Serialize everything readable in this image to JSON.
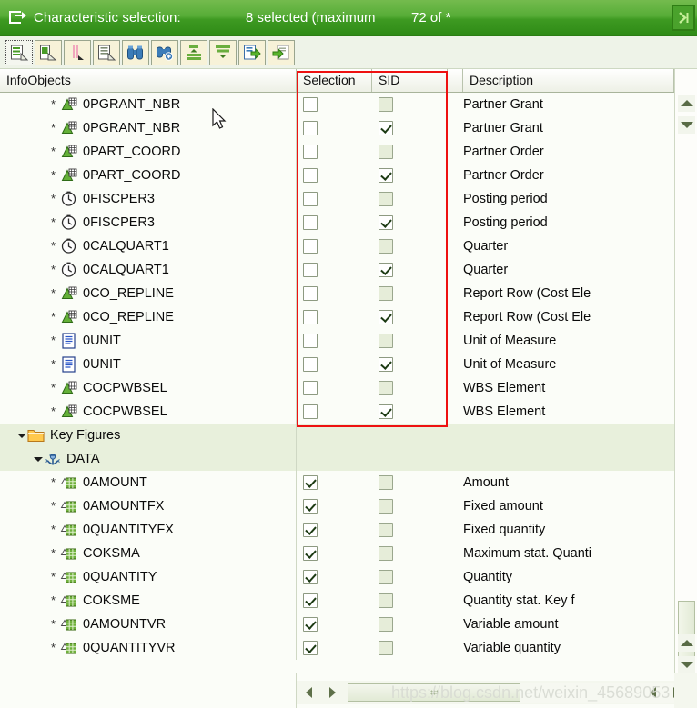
{
  "window": {
    "icon": "selection-window-icon",
    "title": "Characteristic selection:",
    "selected_info": "8 selected (maximum",
    "count_info": "72 of *",
    "close_label": "⌫"
  },
  "toolbar": {
    "buttons": [
      {
        "name": "select-all-button",
        "tip": "Select All"
      },
      {
        "name": "select-block-button",
        "tip": "Select Block"
      },
      {
        "name": "deselect-all-button",
        "tip": "Deselect All"
      },
      {
        "name": "find-button",
        "tip": "Find"
      },
      {
        "name": "find-next-button",
        "tip": "Find Next"
      },
      {
        "name": "expand-nodes-button",
        "tip": "Expand Nodes"
      },
      {
        "name": "collapse-nodes-button",
        "tip": "Collapse Nodes"
      },
      {
        "name": "transfer-button",
        "tip": "Transfer"
      },
      {
        "name": "copy-button",
        "tip": "Copy"
      }
    ]
  },
  "columns": {
    "infoobjects": "InfoObjects",
    "selection": "Selection",
    "sid": "SID",
    "description": "Description"
  },
  "rows": [
    {
      "kind": "item",
      "indent": 2,
      "icon": "characteristic-icon",
      "label": "0PGRANT_NBR",
      "selection": false,
      "sid": false,
      "sid_disabled": true,
      "description": "Partner Grant"
    },
    {
      "kind": "item",
      "indent": 2,
      "icon": "characteristic-icon",
      "label": "0PGRANT_NBR",
      "selection": false,
      "sid": true,
      "sid_disabled": false,
      "description": "Partner Grant"
    },
    {
      "kind": "item",
      "indent": 2,
      "icon": "characteristic-icon",
      "label": "0PART_COORD",
      "selection": false,
      "sid": false,
      "sid_disabled": true,
      "description": "Partner Order"
    },
    {
      "kind": "item",
      "indent": 2,
      "icon": "characteristic-icon",
      "label": "0PART_COORD",
      "selection": false,
      "sid": true,
      "sid_disabled": false,
      "description": "Partner Order"
    },
    {
      "kind": "item",
      "indent": 2,
      "icon": "time-characteristic-icon",
      "label": "0FISCPER3",
      "selection": false,
      "sid": false,
      "sid_disabled": true,
      "description": "Posting period"
    },
    {
      "kind": "item",
      "indent": 2,
      "icon": "time-characteristic-icon",
      "label": "0FISCPER3",
      "selection": false,
      "sid": true,
      "sid_disabled": false,
      "description": "Posting period"
    },
    {
      "kind": "item",
      "indent": 2,
      "icon": "time-characteristic-icon",
      "label": "0CALQUART1",
      "selection": false,
      "sid": false,
      "sid_disabled": true,
      "description": "Quarter"
    },
    {
      "kind": "item",
      "indent": 2,
      "icon": "time-characteristic-icon",
      "label": "0CALQUART1",
      "selection": false,
      "sid": true,
      "sid_disabled": false,
      "description": "Quarter"
    },
    {
      "kind": "item",
      "indent": 2,
      "icon": "characteristic-icon",
      "label": "0CO_REPLINE",
      "selection": false,
      "sid": false,
      "sid_disabled": true,
      "description": "Report Row (Cost Ele"
    },
    {
      "kind": "item",
      "indent": 2,
      "icon": "characteristic-icon",
      "label": "0CO_REPLINE",
      "selection": false,
      "sid": true,
      "sid_disabled": false,
      "description": "Report Row (Cost Ele"
    },
    {
      "kind": "item",
      "indent": 2,
      "icon": "unit-icon",
      "label": "0UNIT",
      "selection": false,
      "sid": false,
      "sid_disabled": true,
      "description": "Unit of Measure"
    },
    {
      "kind": "item",
      "indent": 2,
      "icon": "unit-icon",
      "label": "0UNIT",
      "selection": false,
      "sid": true,
      "sid_disabled": false,
      "description": "Unit of Measure"
    },
    {
      "kind": "item",
      "indent": 2,
      "icon": "characteristic-icon",
      "label": "COCPWBSEL",
      "selection": false,
      "sid": false,
      "sid_disabled": true,
      "description": "WBS Element"
    },
    {
      "kind": "item",
      "indent": 2,
      "icon": "characteristic-icon",
      "label": "COCPWBSEL",
      "selection": false,
      "sid": true,
      "sid_disabled": false,
      "description": "WBS Element"
    },
    {
      "kind": "folder",
      "indent": 0,
      "icon": "folder-icon",
      "label": "Key Figures",
      "expanded": true,
      "description": ""
    },
    {
      "kind": "folder",
      "indent": 1,
      "icon": "data-node-icon",
      "label": "DATA",
      "expanded": true,
      "description": ""
    },
    {
      "kind": "item",
      "indent": 2,
      "icon": "key-figure-icon",
      "label": "0AMOUNT",
      "selection": true,
      "sid": false,
      "sid_disabled": true,
      "description": "Amount"
    },
    {
      "kind": "item",
      "indent": 2,
      "icon": "key-figure-icon",
      "label": "0AMOUNTFX",
      "selection": true,
      "sid": false,
      "sid_disabled": true,
      "description": "Fixed amount"
    },
    {
      "kind": "item",
      "indent": 2,
      "icon": "key-figure-icon",
      "label": "0QUANTITYFX",
      "selection": true,
      "sid": false,
      "sid_disabled": true,
      "description": "Fixed quantity"
    },
    {
      "kind": "item",
      "indent": 2,
      "icon": "key-figure-icon",
      "label": "COKSMA",
      "selection": true,
      "sid": false,
      "sid_disabled": true,
      "description": "Maximum stat. Quanti"
    },
    {
      "kind": "item",
      "indent": 2,
      "icon": "key-figure-icon",
      "label": "0QUANTITY",
      "selection": true,
      "sid": false,
      "sid_disabled": true,
      "description": "Quantity"
    },
    {
      "kind": "item",
      "indent": 2,
      "icon": "key-figure-icon",
      "label": "COKSME",
      "selection": true,
      "sid": false,
      "sid_disabled": true,
      "description": "Quantity stat. Key f"
    },
    {
      "kind": "item",
      "indent": 2,
      "icon": "key-figure-icon",
      "label": "0AMOUNTVR",
      "selection": true,
      "sid": false,
      "sid_disabled": true,
      "description": "Variable amount"
    },
    {
      "kind": "item",
      "indent": 2,
      "icon": "key-figure-icon",
      "label": "0QUANTITYVR",
      "selection": true,
      "sid": false,
      "sid_disabled": true,
      "description": "Variable quantity"
    }
  ],
  "annotation": {
    "highlight_color": "#ee1111",
    "name": "selection-sid-columns-highlight"
  },
  "watermark": "https://blog.csdn.net/weixin_45689053",
  "colors": {
    "title_green": "#4aa22c",
    "row_bg": "#fbfdf8",
    "group_bg": "#e8f0dc",
    "header_border": "#a8b49b"
  }
}
